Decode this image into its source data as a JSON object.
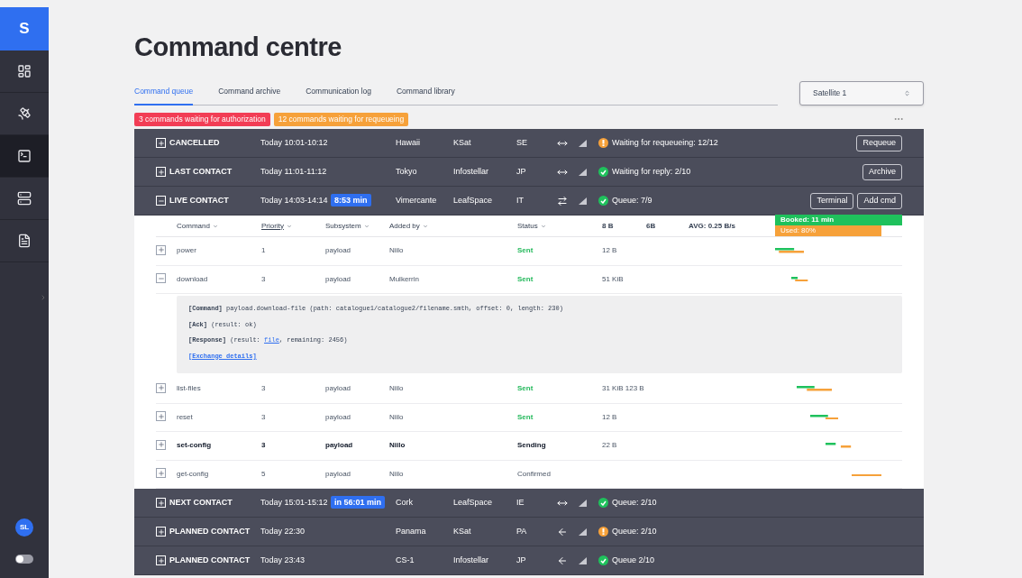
{
  "sidebar": {
    "logo": "S",
    "items": [
      {
        "selected": false
      },
      {
        "selected": false
      },
      {
        "selected": true
      },
      {
        "selected": false
      },
      {
        "selected": false
      }
    ],
    "avatar": "SL",
    "dark_mode": false
  },
  "title": "Command centre",
  "tabs": [
    {
      "label": "Command queue",
      "selected": true
    },
    {
      "label": "Command archive",
      "selected": false
    },
    {
      "label": "Communication log",
      "selected": false
    },
    {
      "label": "Command library",
      "selected": false
    }
  ],
  "satellite_select": {
    "value": "Satellite 1"
  },
  "alerts": [
    {
      "text": "3 commands waiting for authorization",
      "color": "#f23d55"
    },
    {
      "text": "12 commands waiting for requeueing",
      "color": "#f6a13a"
    }
  ],
  "contacts_before": [
    {
      "name": "CANCELLED",
      "expanded": false,
      "time": "Today 10:01-10:12",
      "location": "Hawaii",
      "provider": "KSat",
      "country": "SE",
      "link": {
        "kind": "both"
      },
      "status": {
        "text": "Waiting for requeueing: 12/12",
        "color": "#f6a13a"
      },
      "buttons": [
        "Requeue"
      ]
    },
    {
      "name": "LAST CONTACT",
      "expanded": false,
      "time": "Today 11:01-11:12",
      "location": "Tokyo",
      "provider": "Infostellar",
      "country": "JP",
      "link": {
        "kind": "both"
      },
      "status": {
        "text": "Waiting for reply: 2/10",
        "color": "#1fc15c"
      },
      "buttons": [
        "Archive"
      ]
    },
    {
      "name": "LIVE CONTACT",
      "expanded": true,
      "time": "Today 14:03-14:14",
      "countdown": "8:53 min",
      "location": "Vimercante",
      "provider": "LeafSpace",
      "country": "IT",
      "link": {
        "kind": "swap"
      },
      "status": {
        "text": "Queue: 7/9",
        "color": "#1fc15c"
      },
      "buttons": [
        "Terminal",
        "Add cmd"
      ]
    }
  ],
  "command_table": {
    "columns": [
      {
        "label": "Command",
        "sorted": false
      },
      {
        "label": "Priority",
        "sorted": true
      },
      {
        "label": "Subsystem",
        "sorted": false
      },
      {
        "label": "Added by",
        "sorted": false
      },
      {
        "label": "Status",
        "sorted": false
      }
    ],
    "totals": [
      "8 B",
      "6B",
      "AVG: 0.25 B/s"
    ],
    "booked": "Booked: 11 min",
    "used": "Used: 80%",
    "level": 0.84,
    "rows": [
      {
        "command": "power",
        "priority": "1",
        "subsystem": "payload",
        "added_by": "Niilo",
        "status": {
          "text": "Sent",
          "kind": "sent"
        },
        "size": "12 B",
        "expanded": false,
        "active": false
      },
      {
        "command": "download",
        "priority": "3",
        "subsystem": "payload",
        "added_by": "Mulkerrin",
        "status": {
          "text": "Sent",
          "kind": "sent"
        },
        "size": "51 KiB",
        "expanded": true,
        "active": false,
        "details": {
          "command": "**[Command]** payload.download-file (path: catalogue1/catalogue2/filename.smth, offset: 0, length: 230)",
          "ack": "**[Ack]** (result: ok)",
          "response_before": "**[Response]** (result: ",
          "response_link": "file",
          "response_after": ", remaining: 2456)",
          "exchange_link": "[Exchange details]"
        }
      },
      {
        "command": "list-files",
        "priority": "3",
        "subsystem": "payload",
        "added_by": "Niilo",
        "status": {
          "text": "Sent",
          "kind": "sent"
        },
        "size": "31 KiB 123 B",
        "expanded": false,
        "active": false
      },
      {
        "command": "reset",
        "priority": "3",
        "subsystem": "payload",
        "added_by": "Niilo",
        "status": {
          "text": "Sent",
          "kind": "sent"
        },
        "size": "12 B",
        "expanded": false,
        "active": false
      },
      {
        "command": "set-config",
        "priority": "3",
        "subsystem": "payload",
        "added_by": "Niilo",
        "status": {
          "text": "Sending",
          "kind": "sending"
        },
        "size": "22 B",
        "expanded": false,
        "active": true
      },
      {
        "command": "get-config",
        "priority": "5",
        "subsystem": "payload",
        "added_by": "Niilo",
        "status": {
          "text": "Confirmed",
          "kind": "confirmed"
        },
        "expanded": false,
        "active": false
      }
    ]
  },
  "contacts_after": [
    {
      "name": "NEXT CONTACT",
      "expanded": false,
      "time": "Today 15:01-15:12",
      "countdown": "in 56:01 min",
      "location": "Cork",
      "provider": "LeafSpace",
      "country": "IE",
      "link": {
        "kind": "both"
      },
      "status": {
        "text": "Queue: 2/10",
        "color": "#1fc15c"
      }
    },
    {
      "name": "PLANNED CONTACT",
      "expanded": false,
      "time": "Today 22:30",
      "location": "Panama",
      "provider": "KSat",
      "country": "PA",
      "link": {
        "kind": "left"
      },
      "status": {
        "text": "Queue: 2/10",
        "color": "#f6a13a"
      }
    },
    {
      "name": "PLANNED CONTACT",
      "expanded": false,
      "time": "Today 23:43",
      "location": "CS-1",
      "provider": "Infostellar",
      "country": "JP",
      "link": {
        "kind": "left"
      },
      "status": {
        "text": "Queue 2/10",
        "color": "#1fc15c"
      }
    }
  ]
}
